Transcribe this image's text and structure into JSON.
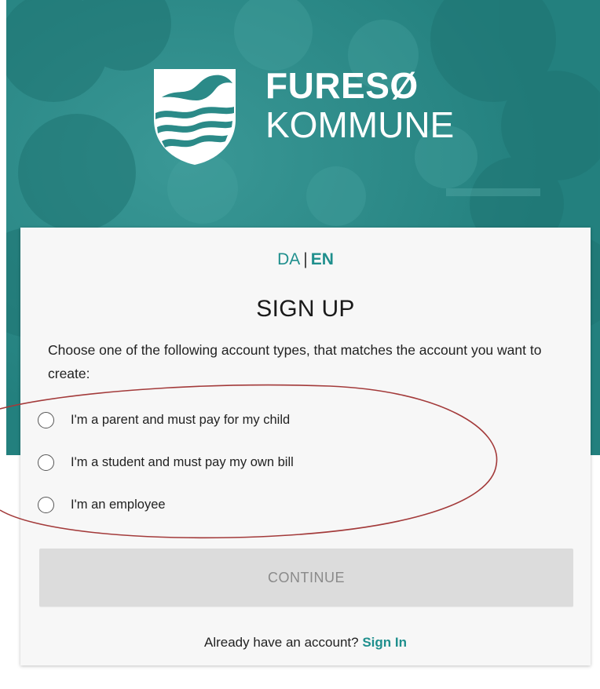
{
  "brand": {
    "line1": "FURESØ",
    "line2": "KOMMUNE",
    "crest_icon": "furesoe-crest-icon",
    "hero_color": "#2b8a88"
  },
  "language": {
    "da": "DA",
    "separator": "|",
    "en": "EN",
    "active": "EN",
    "accent_color": "#1f8f8d"
  },
  "form": {
    "title": "SIGN UP",
    "description": "Choose one of the following account types, that matches the account you want to create:",
    "options": [
      {
        "label": "I'm a parent and must pay for my child",
        "selected": false
      },
      {
        "label": "I'm a student and must pay my own bill",
        "selected": false
      },
      {
        "label": "I'm an employee",
        "selected": false
      }
    ],
    "continue_label": "CONTINUE",
    "continue_enabled": false
  },
  "footer": {
    "prompt": "Already have an account?",
    "signin_label": "Sign In"
  },
  "annotation": {
    "type": "freehand-ellipse",
    "color": "#a33a3a"
  }
}
